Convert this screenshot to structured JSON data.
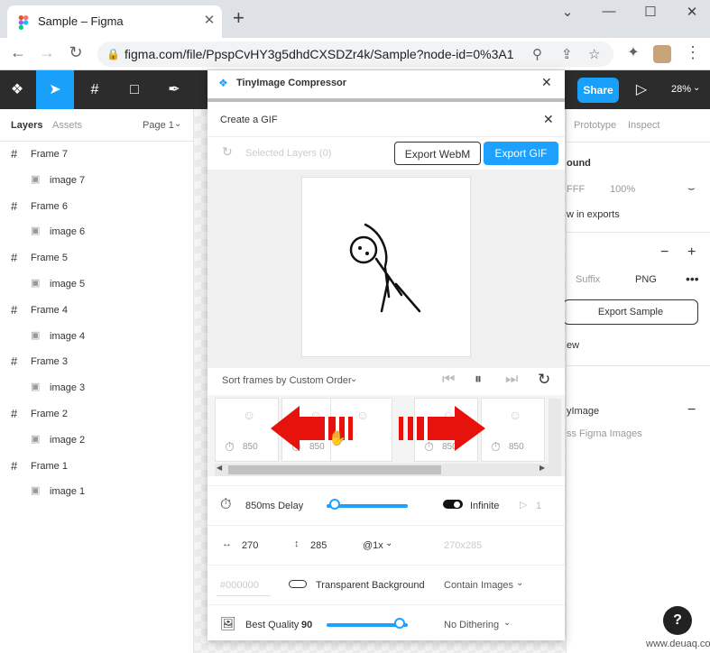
{
  "browser": {
    "tab_title": "Sample – Figma",
    "url": "figma.com/file/PpspCvHY3g5dhdCXSDZr4k/Sample?node-id=0%3A1",
    "new_tab": "+",
    "window_controls": [
      "⌄",
      "—",
      "☐",
      "✕"
    ]
  },
  "figma_toolbar": {
    "share_label": "Share",
    "zoom": "28%"
  },
  "layers_panel": {
    "tabs": [
      "Layers",
      "Assets"
    ],
    "page": "Page 1",
    "items": [
      {
        "label": "Frame 7",
        "type": "frame"
      },
      {
        "label": "image 7",
        "type": "image"
      },
      {
        "label": "Frame 6",
        "type": "frame"
      },
      {
        "label": "image 6",
        "type": "image"
      },
      {
        "label": "Frame 5",
        "type": "frame"
      },
      {
        "label": "image 5",
        "type": "image"
      },
      {
        "label": "Frame 4",
        "type": "frame"
      },
      {
        "label": "image 4",
        "type": "image"
      },
      {
        "label": "Frame 3",
        "type": "frame"
      },
      {
        "label": "image 3",
        "type": "image"
      },
      {
        "label": "Frame 2",
        "type": "frame"
      },
      {
        "label": "image 2",
        "type": "image"
      },
      {
        "label": "Frame 1",
        "type": "frame"
      },
      {
        "label": "image 1",
        "type": "image"
      }
    ]
  },
  "right_panel": {
    "tabs": [
      "Prototype",
      "Inspect"
    ],
    "background_label": "ound",
    "fill_hex": "FFF",
    "fill_opacity": "100%",
    "show_exports": "w in exports",
    "suffix_placeholder": "Suffix",
    "format": "PNG",
    "export_button": "Export Sample",
    "preview": "ew",
    "plugin_label": "yImage",
    "plugin_desc": "ss Figma Images"
  },
  "plugin": {
    "title": "TinyImage Compressor",
    "dialog_title": "Create a GIF",
    "selected_layers": "Selected Layers (0)",
    "export_webm": "Export WebM",
    "export_gif": "Export GIF",
    "sort_label": "Sort frames by Custom Order",
    "frames": [
      {
        "delay": "850"
      },
      {
        "delay": "850"
      },
      {
        "delay": ""
      },
      {
        "delay": "850"
      },
      {
        "delay": "850"
      }
    ],
    "delay_label": "850ms Delay",
    "delay_fraction": 0.1,
    "infinite_label": "Infinite",
    "repeat_count": "1",
    "width": "270",
    "height": "285",
    "scale": "@1x",
    "dimension_display": "270x285",
    "bg_color_placeholder": "#000000",
    "transparent_label": "Transparent Background",
    "contain_label": "Contain Images",
    "quality_label": "Best Quality",
    "quality_value": "90",
    "quality_fraction": 0.9,
    "dithering": "No Dithering"
  },
  "help_label": "?",
  "watermark": "www.deuaq.com"
}
